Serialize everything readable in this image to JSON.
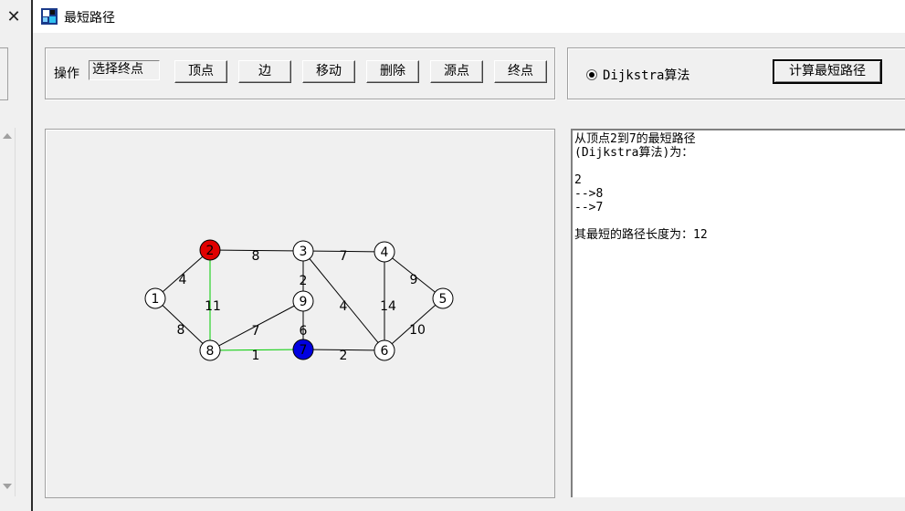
{
  "window": {
    "title": "最短路径",
    "app_icon": "graph-app-icon"
  },
  "ops": {
    "label": "操作",
    "current_mode": "选择终点",
    "buttons": {
      "vertex": "顶点",
      "edge": "边",
      "move": "移动",
      "delete": "删除",
      "source": "源点",
      "target": "终点"
    }
  },
  "algorithm": {
    "option": "Dijkstra算法",
    "selected": true,
    "calc_button": "计算最短路径"
  },
  "graph": {
    "vertices": [
      {
        "id": "1",
        "state": "normal"
      },
      {
        "id": "2",
        "state": "source"
      },
      {
        "id": "3",
        "state": "normal"
      },
      {
        "id": "4",
        "state": "normal"
      },
      {
        "id": "5",
        "state": "normal"
      },
      {
        "id": "6",
        "state": "normal"
      },
      {
        "id": "7",
        "state": "target"
      },
      {
        "id": "8",
        "state": "normal"
      },
      {
        "id": "9",
        "state": "normal"
      }
    ],
    "edges": [
      {
        "from": "1",
        "to": "2",
        "weight": "4",
        "on_path": false
      },
      {
        "from": "1",
        "to": "8",
        "weight": "8",
        "on_path": false
      },
      {
        "from": "2",
        "to": "3",
        "weight": "8",
        "on_path": false
      },
      {
        "from": "2",
        "to": "8",
        "weight": "11",
        "on_path": true
      },
      {
        "from": "3",
        "to": "4",
        "weight": "7",
        "on_path": false
      },
      {
        "from": "3",
        "to": "9",
        "weight": "2",
        "on_path": false
      },
      {
        "from": "3",
        "to": "6",
        "weight": "4",
        "on_path": false
      },
      {
        "from": "4",
        "to": "5",
        "weight": "9",
        "on_path": false
      },
      {
        "from": "4",
        "to": "6",
        "weight": "14",
        "on_path": false
      },
      {
        "from": "5",
        "to": "6",
        "weight": "10",
        "on_path": false
      },
      {
        "from": "6",
        "to": "7",
        "weight": "2",
        "on_path": false
      },
      {
        "from": "7",
        "to": "8",
        "weight": "1",
        "on_path": true
      },
      {
        "from": "7",
        "to": "9",
        "weight": "6",
        "on_path": false
      },
      {
        "from": "8",
        "to": "9",
        "weight": "7",
        "on_path": false
      }
    ],
    "colors": {
      "source": "#e00000",
      "target": "#0000e0",
      "path": "#00cc00",
      "edge": "#000000",
      "vertex_fill": "#ffffff"
    }
  },
  "result": {
    "lines": [
      "从顶点2到7的最短路径",
      "(Dijkstra算法)为：",
      "",
      "2",
      "-->8",
      "-->7",
      "",
      "其最短的路径长度为：12"
    ]
  }
}
